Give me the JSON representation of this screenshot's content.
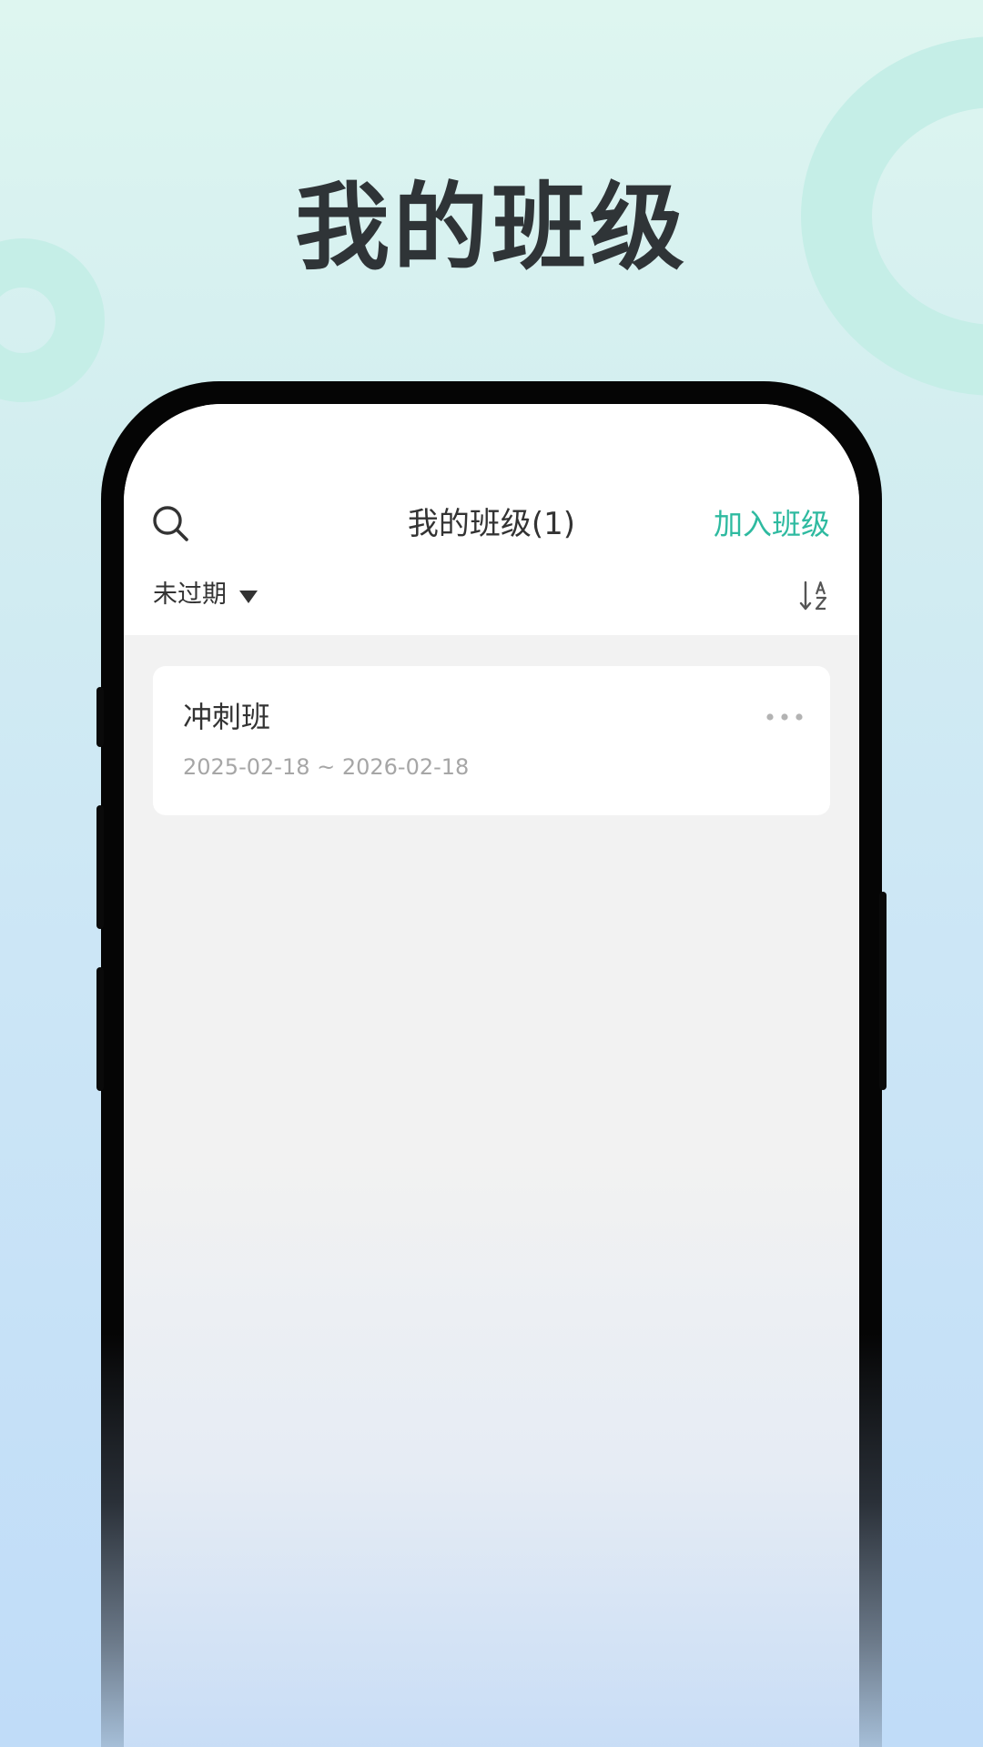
{
  "hero": {
    "title": "我的班级"
  },
  "nav": {
    "title": "我的班级(1)",
    "join_label": "加入班级"
  },
  "filter": {
    "selected": "未过期"
  },
  "classes": [
    {
      "name": "冲刺班",
      "dates": "2025-02-18 ~ 2026-02-18"
    }
  ],
  "colors": {
    "accent": "#2ebaa0",
    "title_text": "#2f3437",
    "screen_bg": "#f2f2f2",
    "ring": "#c5eee7"
  },
  "icons": [
    "search-icon",
    "caret-down-icon",
    "sort-az-icon",
    "more-icon"
  ]
}
